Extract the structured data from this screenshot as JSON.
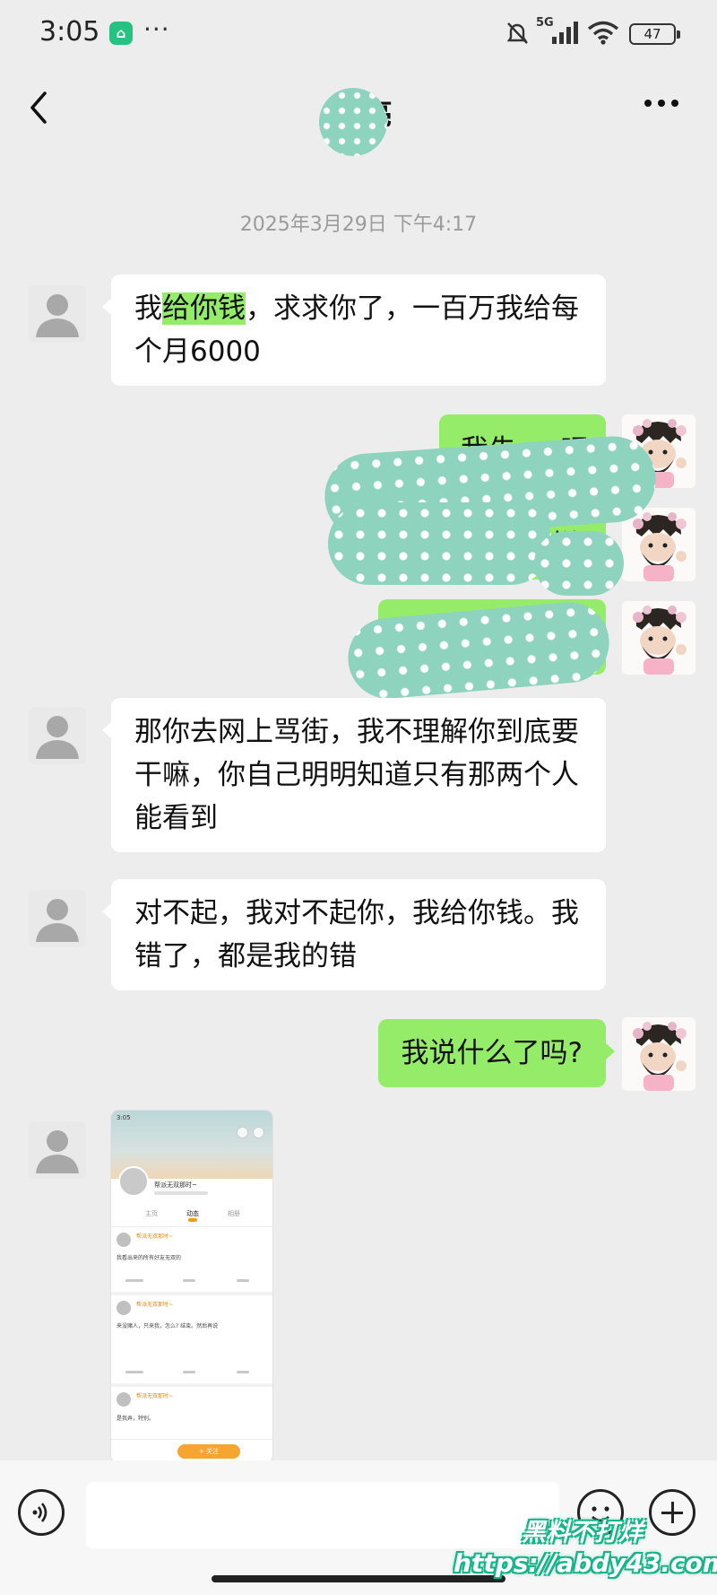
{
  "status_bar": {
    "time": "3:05",
    "app_badge_icon": "mi-app-icon",
    "dots": "···",
    "network": "5G",
    "battery": "47"
  },
  "nav": {
    "title": "杨 亮",
    "back_icon": "chevron-left-icon",
    "more_icon": "more-horizontal-icon"
  },
  "timestamp": "2025年3月29日 下午4:17",
  "messages": [
    {
      "side": "in",
      "text_pre": "我",
      "text_hl": "给你钱",
      "text_post": "，求求你了，一百万我给每个月6000"
    },
    {
      "side": "out",
      "partial": "我先 ... 吧"
    },
    {
      "side": "out",
      "partial": "这样"
    },
    {
      "side": "out",
      "partial": ""
    },
    {
      "side": "in",
      "text": "那你去网上骂街，我不理解你到底要干嘛，你自己明明知道只有那两个人能看到"
    },
    {
      "side": "in",
      "text": "对不起，我对不起你，我给你钱。我错了，都是我的错"
    },
    {
      "side": "out",
      "text": "我说什么了吗?"
    }
  ],
  "shared_screenshot": {
    "status_time": "3:05",
    "profile_name": "帮派无双那时~",
    "tabs": [
      "主页",
      "动态",
      "相册"
    ],
    "posts": [
      {
        "name": "帮派无双那时~",
        "text": "我看出来的所有好友无双的"
      },
      {
        "name": "帮派无双那时~",
        "text": "来没赌人，只来我，怎么? 结束。然后再说"
      },
      {
        "name": "帮派无双那时~",
        "text": "是我弄，特别。"
      }
    ],
    "button": "+ 关注"
  },
  "input_bar": {
    "voice_icon": "voice-icon",
    "emoji_icon": "emoji-icon",
    "plus_icon": "plus-icon",
    "placeholder": ""
  },
  "watermark": {
    "line1": "黑料不打烊",
    "line2": "https://abdy43.com"
  },
  "colors": {
    "bubble_out": "#95ec69",
    "bubble_in": "#ffffff",
    "background": "#ededed",
    "blur": "#8ed3bd"
  }
}
